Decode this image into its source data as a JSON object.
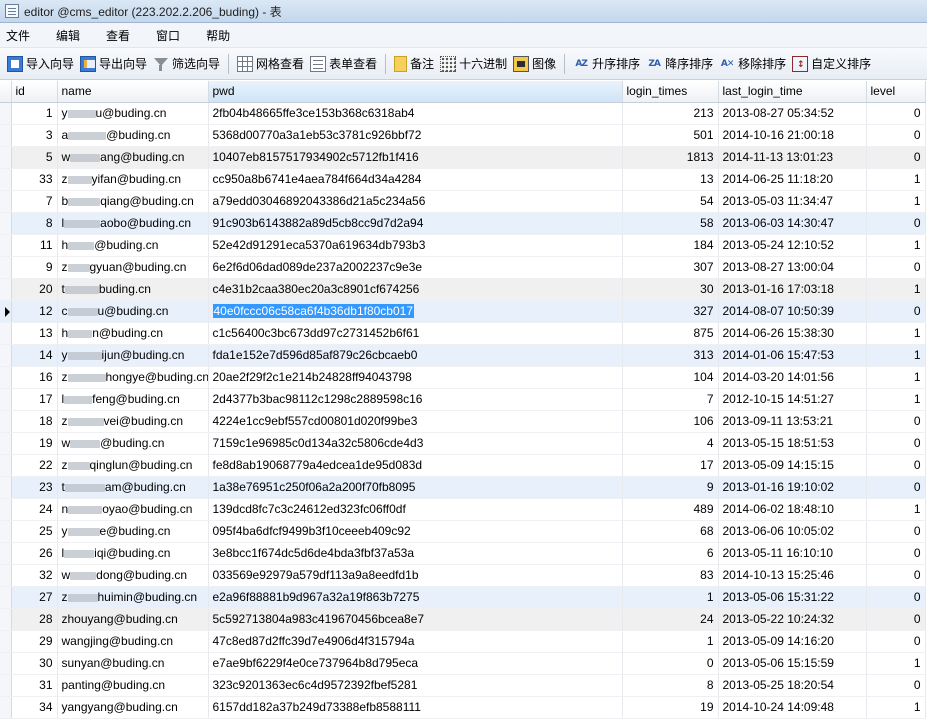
{
  "window": {
    "title": "editor @cms_editor (223.202.2.206_buding) - 表"
  },
  "menu": [
    "文件",
    "编辑",
    "查看",
    "窗口",
    "帮助"
  ],
  "toolbar": {
    "import_wizard": "导入向导",
    "export_wizard": "导出向导",
    "filter_wizard": "筛选向导",
    "grid_view": "网格查看",
    "form_view": "表单查看",
    "memo": "备注",
    "hex": "十六进制",
    "image": "图像",
    "sort_asc": "升序排序",
    "sort_desc": "降序排序",
    "remove_sort": "移除排序",
    "custom_sort": "自定义排序"
  },
  "table": {
    "columns": [
      "id",
      "name",
      "pwd",
      "login_times",
      "last_login_time",
      "level"
    ],
    "current_row_index": 9,
    "selected_column": "pwd",
    "rows": [
      {
        "id": "1",
        "name_prefix": "y",
        "name_suffix": "u@buding.cn",
        "pwd": "2fb04b48665ffe3ce153b368c6318ab4",
        "login_times": "213",
        "last_login_time": "2013-08-27 05:34:52",
        "level": "0"
      },
      {
        "id": "3",
        "name_prefix": "a",
        "name_suffix": "@buding.cn",
        "pwd": "5368d00770a3a1eb53c3781c926bbf72",
        "login_times": "501",
        "last_login_time": "2014-10-16 21:00:18",
        "level": "0"
      },
      {
        "id": "5",
        "name_prefix": "w",
        "name_suffix": "ang@buding.cn",
        "pwd": "10407eb8157517934902c5712fb1f416",
        "login_times": "1813",
        "last_login_time": "2014-11-13 13:01:23",
        "level": "0"
      },
      {
        "id": "33",
        "name_prefix": "z",
        "name_suffix": "yifan@buding.cn",
        "pwd": "cc950a8b6741e4aea784f664d34a4284",
        "login_times": "13",
        "last_login_time": "2014-06-25 11:18:20",
        "level": "1"
      },
      {
        "id": "7",
        "name_prefix": "b",
        "name_suffix": "qiang@buding.cn",
        "pwd": "a79edd03046892043386d21a5c234a56",
        "login_times": "54",
        "last_login_time": "2013-05-03 11:34:47",
        "level": "1"
      },
      {
        "id": "8",
        "name_prefix": "l",
        "name_suffix": "aobo@buding.cn",
        "pwd": "91c903b6143882a89d5cb8cc9d7d2a94",
        "login_times": "58",
        "last_login_time": "2013-06-03 14:30:47",
        "level": "0"
      },
      {
        "id": "11",
        "name_prefix": "h",
        "name_suffix": "@buding.cn",
        "pwd": "52e42d91291eca5370a619634db793b3",
        "login_times": "184",
        "last_login_time": "2013-05-24 12:10:52",
        "level": "1"
      },
      {
        "id": "9",
        "name_prefix": "z",
        "name_suffix": "gyuan@buding.cn",
        "pwd": "6e2f6d06dad089de237a2002237c9e3e",
        "login_times": "307",
        "last_login_time": "2013-08-27 13:00:04",
        "level": "0"
      },
      {
        "id": "20",
        "name_prefix": "t",
        "name_suffix": "buding.cn",
        "pwd": "c4e31b2caa380ec20a3c8901cf674256",
        "login_times": "30",
        "last_login_time": "2013-01-16 17:03:18",
        "level": "1"
      },
      {
        "id": "12",
        "name_prefix": "c",
        "name_suffix": "u@buding.cn",
        "pwd": "40e0fccc06c58ca6f4b36db1f80cb017",
        "login_times": "327",
        "last_login_time": "2014-08-07 10:50:39",
        "level": "0"
      },
      {
        "id": "13",
        "name_prefix": "h",
        "name_suffix": "n@buding.cn",
        "pwd": "c1c56400c3bc673dd97c2731452b6f61",
        "login_times": "875",
        "last_login_time": "2014-06-26 15:38:30",
        "level": "1"
      },
      {
        "id": "14",
        "name_prefix": "y",
        "name_suffix": "ijun@buding.cn",
        "pwd": "fda1e152e7d596d85af879c26cbcaeb0",
        "login_times": "313",
        "last_login_time": "2014-01-06 15:47:53",
        "level": "1"
      },
      {
        "id": "16",
        "name_prefix": "z",
        "name_suffix": "hongye@buding.cn",
        "pwd": "20ae2f29f2c1e214b24828ff94043798",
        "login_times": "104",
        "last_login_time": "2014-03-20 14:01:56",
        "level": "1"
      },
      {
        "id": "17",
        "name_prefix": "l",
        "name_suffix": "feng@buding.cn",
        "pwd": "2d4377b3bac98112c1298c2889598c16",
        "login_times": "7",
        "last_login_time": "2012-10-15 14:51:27",
        "level": "1"
      },
      {
        "id": "18",
        "name_prefix": "z",
        "name_suffix": "vei@buding.cn",
        "pwd": "4224e1cc9ebf557cd00801d020f99be3",
        "login_times": "106",
        "last_login_time": "2013-09-11 13:53:21",
        "level": "0"
      },
      {
        "id": "19",
        "name_prefix": "w",
        "name_suffix": "@buding.cn",
        "pwd": "7159c1e96985c0d134a32c5806cde4d3",
        "login_times": "4",
        "last_login_time": "2013-05-15 18:51:53",
        "level": "0"
      },
      {
        "id": "22",
        "name_prefix": "z",
        "name_suffix": "qinglun@buding.cn",
        "pwd": "fe8d8ab19068779a4edcea1de95d083d",
        "login_times": "17",
        "last_login_time": "2013-05-09 14:15:15",
        "level": "0"
      },
      {
        "id": "23",
        "name_prefix": "t",
        "name_suffix": "am@buding.cn",
        "pwd": "1a38e76951c250f06a2a200f70fb8095",
        "login_times": "9",
        "last_login_time": "2013-01-16 19:10:02",
        "level": "0"
      },
      {
        "id": "24",
        "name_prefix": "n",
        "name_suffix": "oyao@buding.cn",
        "pwd": "139dcd8fc7c3c24612ed323fc06ff0df",
        "login_times": "489",
        "last_login_time": "2014-06-02 18:48:10",
        "level": "1"
      },
      {
        "id": "25",
        "name_prefix": "y",
        "name_suffix": "e@buding.cn",
        "pwd": "095f4ba6dfcf9499b3f10ceeeb409c92",
        "login_times": "68",
        "last_login_time": "2013-06-06 10:05:02",
        "level": "0"
      },
      {
        "id": "26",
        "name_prefix": "l",
        "name_suffix": "iqi@buding.cn",
        "pwd": "3e8bcc1f674dc5d6de4bda3fbf37a53a",
        "login_times": "6",
        "last_login_time": "2013-05-11 16:10:10",
        "level": "0"
      },
      {
        "id": "32",
        "name_prefix": "w",
        "name_suffix": "dong@buding.cn",
        "pwd": "033569e92979a579df113a9a8eedfd1b",
        "login_times": "83",
        "last_login_time": "2014-10-13 15:25:46",
        "level": "0"
      },
      {
        "id": "27",
        "name_prefix": "z",
        "name_suffix": "huimin@buding.cn",
        "pwd": "e2a96f88881b9d967a32a19f863b7275",
        "login_times": "1",
        "last_login_time": "2013-05-06 15:31:22",
        "level": "0"
      },
      {
        "id": "28",
        "name_prefix": "",
        "name_suffix": "zhouyang@buding.cn",
        "pwd": "5c592713804a983c419670456bcea8e7",
        "login_times": "24",
        "last_login_time": "2013-05-22 10:24:32",
        "level": "0"
      },
      {
        "id": "29",
        "name_prefix": "",
        "name_suffix": "wangjing@buding.cn",
        "pwd": "47c8ed87d2ffc39d7e4906d4f315794a",
        "login_times": "1",
        "last_login_time": "2013-05-09 14:16:20",
        "level": "0"
      },
      {
        "id": "30",
        "name_prefix": "",
        "name_suffix": "sunyan@buding.cn",
        "pwd": "e7ae9bf6229f4e0ce737964b8d795eca",
        "login_times": "0",
        "last_login_time": "2013-05-06 15:15:59",
        "level": "1"
      },
      {
        "id": "31",
        "name_prefix": "",
        "name_suffix": "panting@buding.cn",
        "pwd": "323c9201363ec6c4d9572392fbef5281",
        "login_times": "8",
        "last_login_time": "2013-05-25 18:20:54",
        "level": "0"
      },
      {
        "id": "34",
        "name_prefix": "",
        "name_suffix": "yangyang@buding.cn",
        "pwd": "6157dd182a37b249d73388efb8588111",
        "login_times": "19",
        "last_login_time": "2014-10-24 14:09:48",
        "level": "1"
      }
    ]
  }
}
